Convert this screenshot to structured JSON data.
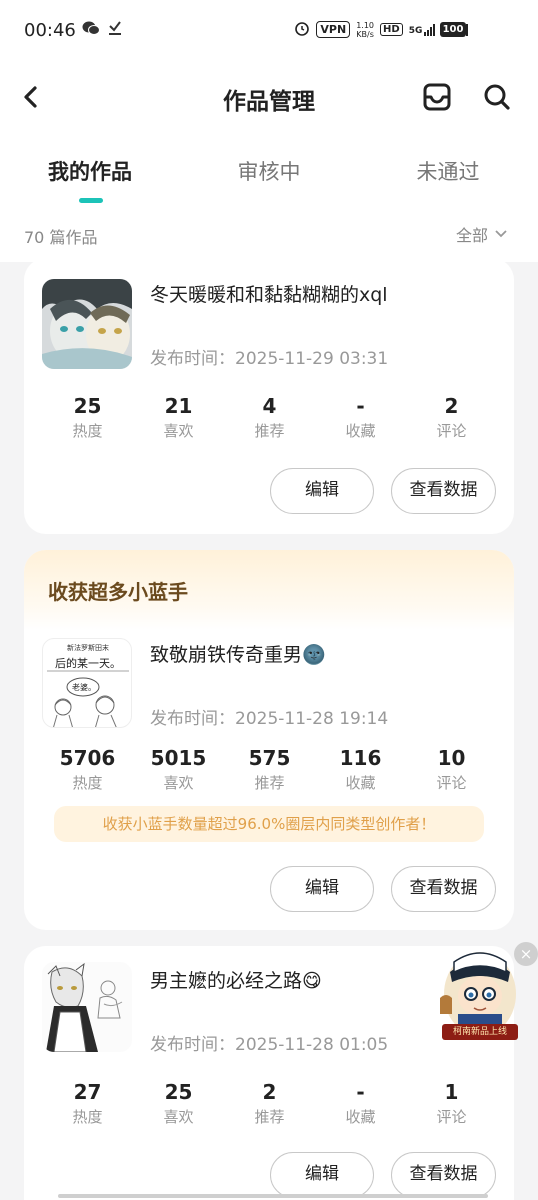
{
  "status_bar": {
    "time": "00:46",
    "vpn": "VPN",
    "net_speed_value": "1.10",
    "net_speed_unit": "KB/s",
    "hd_label": "HD",
    "signal_1": "5G",
    "signal_2": "4G",
    "battery": "100"
  },
  "header": {
    "title": "作品管理",
    "back_icon": "chevron-left-icon",
    "message_icon": "message-box-icon",
    "search_icon": "search-icon"
  },
  "tabs": [
    {
      "label": "我的作品",
      "active": true
    },
    {
      "label": "审核中",
      "active": false
    },
    {
      "label": "未通过",
      "active": false
    }
  ],
  "summary": {
    "count_text": "70 篇作品",
    "filter_label": "全部"
  },
  "works": [
    {
      "title": "冬天暖暖和和黏黏糊糊的xql",
      "publish_time": "发布时间：2025-11-29 03:31",
      "stats": [
        {
          "value": "25",
          "label": "热度"
        },
        {
          "value": "21",
          "label": "喜欢"
        },
        {
          "value": "4",
          "label": "推荐"
        },
        {
          "value": "-",
          "label": "收藏"
        },
        {
          "value": "2",
          "label": "评论"
        }
      ],
      "edit_label": "编辑",
      "data_label": "查看数据"
    },
    {
      "banner": "收获超多小蓝手",
      "title": "致敬崩铁传奇重男🌚",
      "publish_time": "发布时间：2025-11-28 19:14",
      "thumb_text_1": "新法罗斯田末",
      "thumb_text_2": "后的某一天。",
      "thumb_text_3": "老婆。",
      "stats": [
        {
          "value": "5706",
          "label": "热度"
        },
        {
          "value": "5015",
          "label": "喜欢"
        },
        {
          "value": "575",
          "label": "推荐"
        },
        {
          "value": "116",
          "label": "收藏"
        },
        {
          "value": "10",
          "label": "评论"
        }
      ],
      "tip": "收获小蓝手数量超过96.0%圈层内同类型创作者！",
      "edit_label": "编辑",
      "data_label": "查看数据"
    },
    {
      "title": "男主嬷的必经之路😋",
      "publish_time": "发布时间：2025-11-28 01:05",
      "stats": [
        {
          "value": "27",
          "label": "热度"
        },
        {
          "value": "25",
          "label": "喜欢"
        },
        {
          "value": "2",
          "label": "推荐"
        },
        {
          "value": "-",
          "label": "收藏"
        },
        {
          "value": "1",
          "label": "评论"
        }
      ],
      "edit_label": "编辑",
      "data_label": "查看数据"
    }
  ],
  "float_ad": {
    "caption": "柯南新品上线",
    "close": "×"
  },
  "colors": {
    "accent": "#1cc3b8",
    "banner_text": "#6b4a1e",
    "tip_text": "#e0a04a",
    "tip_bg": "#fff3df"
  }
}
